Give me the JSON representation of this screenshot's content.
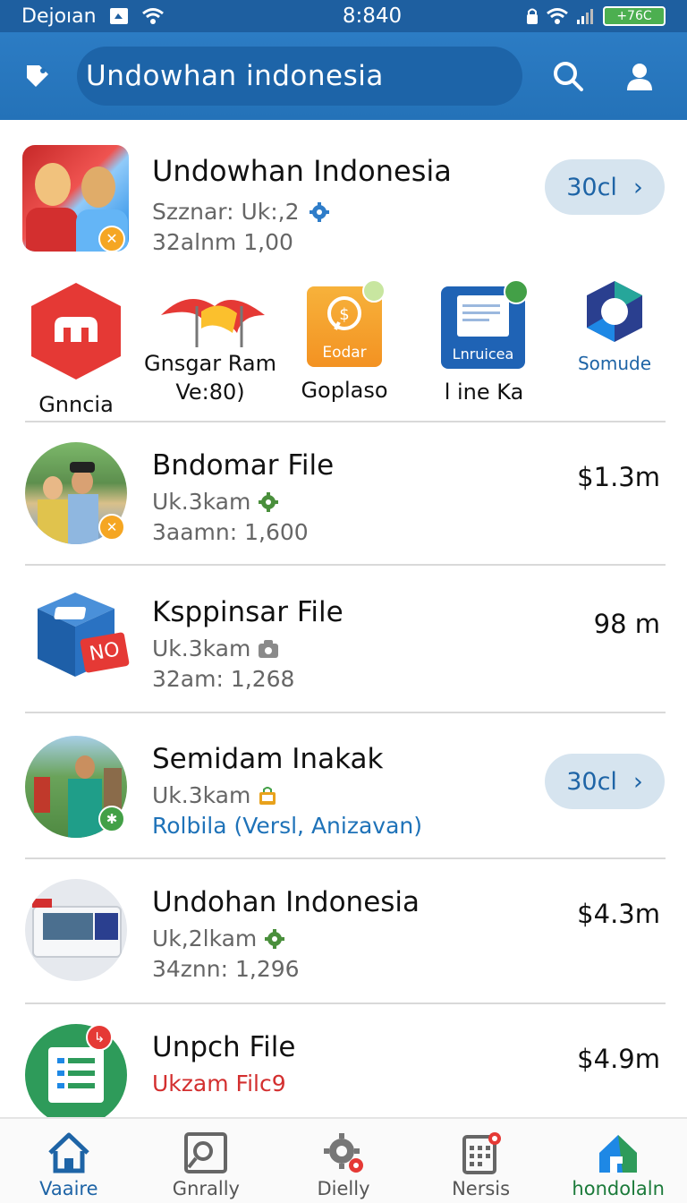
{
  "status_bar": {
    "carrier": "Dejoıan",
    "time": "8:840",
    "battery": "+76C"
  },
  "header": {
    "search_text": "Undowhan indonesia",
    "icons": [
      "tag-icon",
      "search-icon",
      "profile-icon"
    ]
  },
  "featured": {
    "title": "Undowhan Indonesia",
    "subtitle": "Szznar: Uk:,2",
    "meta": "32alnm 1,00",
    "button_label": "30cl",
    "chevron": "›"
  },
  "apps": [
    {
      "label": "Gnncia",
      "icon": "hexagon-app-icon"
    },
    {
      "label": "Gnsgar Ram",
      "label2": "Ve:80)",
      "icon": "flags-app-icon"
    },
    {
      "label": "Goplaso",
      "icon_text": "Eodar",
      "icon": "chat-app-icon"
    },
    {
      "label": "l ine Ka",
      "icon_text": "Lnruicea",
      "icon": "document-app-icon"
    },
    {
      "label": "Somude",
      "icon": "polygon-app-icon"
    }
  ],
  "items": [
    {
      "title": "Bndomar File",
      "subtitle": "Uk.3kam",
      "meta": "3aamn: 1,600",
      "price": "$1.3m",
      "icon": "gear-icon"
    },
    {
      "title": "Ksppinsar File",
      "subtitle": "Uk.3kam",
      "meta": "32am: 1,268",
      "price": "98 m",
      "icon": "camera-icon",
      "thumb_text": "NO"
    },
    {
      "title": "Semidam Inakak",
      "subtitle": "Uk.3kam",
      "meta": "Rolbila (Versl, Anizavan)",
      "button_label": "30cl",
      "chevron": "›",
      "icon": "bag-icon"
    },
    {
      "title": "Undohan Indonesia",
      "subtitle": "Uk,2lkam",
      "meta": "34znn: 1,296",
      "price": "$4.3m",
      "icon": "gear-icon"
    },
    {
      "title": "Unpch File",
      "subtitle": "Ukzam Filc9",
      "price": "$4.9m"
    }
  ],
  "bottom_nav": [
    {
      "label": "Vaaire",
      "icon": "home-icon"
    },
    {
      "label": "Gnrally",
      "icon": "gallery-icon"
    },
    {
      "label": "Dielly",
      "icon": "settings-icon"
    },
    {
      "label": "Nersis",
      "icon": "calendar-icon"
    },
    {
      "label": "hondolaln",
      "icon": "brand-home-icon"
    }
  ],
  "colors": {
    "header_blue": "#2472b8",
    "accent_blue": "#1e64a6",
    "pill_bg": "#d6e4ef",
    "gear_green": "#4a8f3c",
    "red": "#d32f2f"
  }
}
